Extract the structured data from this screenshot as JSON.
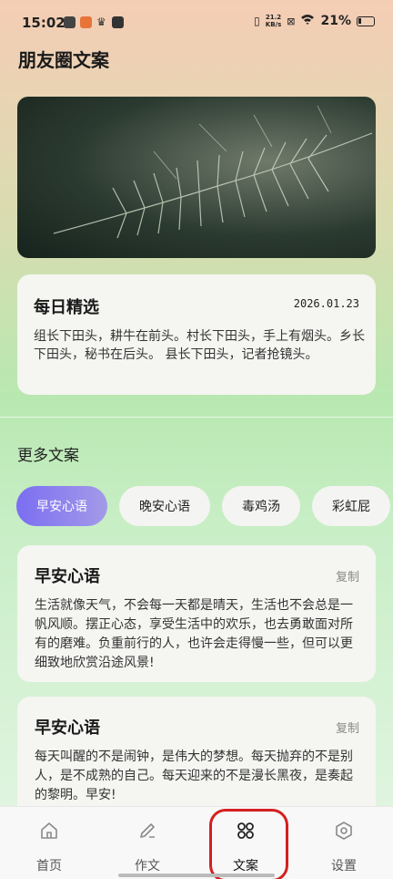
{
  "status_bar": {
    "time": "15:02",
    "net_speed_top": "21.2",
    "net_speed_bottom": "KB/s",
    "battery": "21%"
  },
  "app": {
    "title": "朋友圈文案"
  },
  "daily": {
    "title": "每日精选",
    "date": "2026.01.23",
    "text": "组长下田头，耕牛在前头。村长下田头，手上有烟头。乡长下田头，秘书在后头。 县长下田头，记者抢镜头。"
  },
  "more": {
    "title": "更多文案"
  },
  "chips": [
    "早安心语",
    "晚安心语",
    "毒鸡汤",
    "彩虹屁"
  ],
  "posts": [
    {
      "title": "早安心语",
      "copy": "复制",
      "text": "生活就像天气，不会每一天都是晴天，生活也不会总是一帆风顺。摆正心态，享受生活中的欢乐，也去勇敢面对所有的磨难。负重前行的人，也许会走得慢一些，但可以更细致地欣赏沿途风景!"
    },
    {
      "title": "早安心语",
      "copy": "复制",
      "text": "每天叫醒的不是闹钟，是伟大的梦想。每天抛弃的不是别人，是不成熟的自己。每天迎来的不是漫长黑夜，是奏起的黎明。早安!"
    }
  ],
  "tabs": [
    {
      "label": "首页",
      "icon": "home-icon"
    },
    {
      "label": "作文",
      "icon": "pencil-icon"
    },
    {
      "label": "文案",
      "icon": "grid-icon"
    },
    {
      "label": "设置",
      "icon": "settings-icon"
    }
  ],
  "colors": {
    "accent": "#7b6ef2",
    "highlight": "#d42020"
  }
}
